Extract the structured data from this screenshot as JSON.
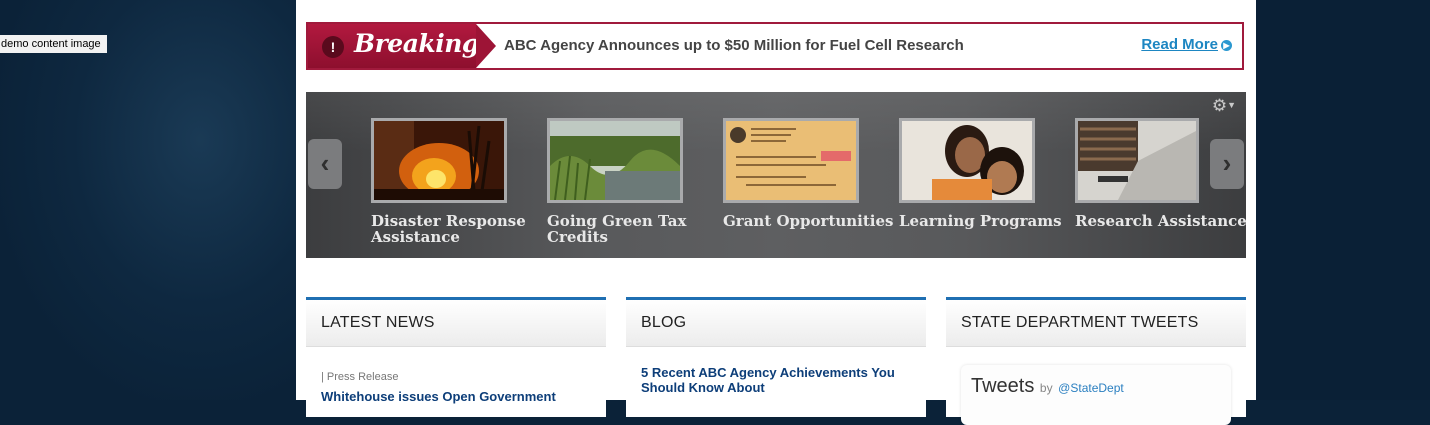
{
  "demo_label": "demo content image",
  "breaking": {
    "label": "Breaking",
    "bang": "!",
    "headline": "ABC Agency Announces up to $50 Million for Fuel Cell Research",
    "read_more": "Read More"
  },
  "carousel": {
    "prev": "‹",
    "next": "›",
    "settings_icon": "gear-icon",
    "slides": [
      {
        "title": "Disaster Response Assistance",
        "image": "fire-scene"
      },
      {
        "title": "Going Green Tax Credits",
        "image": "wetland-scene"
      },
      {
        "title": "Grant Opportunities",
        "image": "check-document"
      },
      {
        "title": "Learning Programs",
        "image": "mother-child"
      },
      {
        "title": "Research Assistance",
        "image": "library-stacks"
      }
    ]
  },
  "columns": {
    "news": {
      "title": "LATEST NEWS",
      "meta": "| Press Release",
      "item": "Whitehouse issues Open Government"
    },
    "blog": {
      "title": "BLOG",
      "item": "5 Recent ABC Agency Achievements You Should Know About"
    },
    "tweets": {
      "title": "STATE DEPARTMENT TWEETS",
      "widget_title": "Tweets",
      "by": "by",
      "handle": "@StateDept"
    }
  },
  "colors": {
    "accent_blue": "#1f6fb2",
    "breaking_red": "#a01a3c",
    "link_blue": "#1d86c2",
    "headline_navy": "#0d3e79"
  }
}
